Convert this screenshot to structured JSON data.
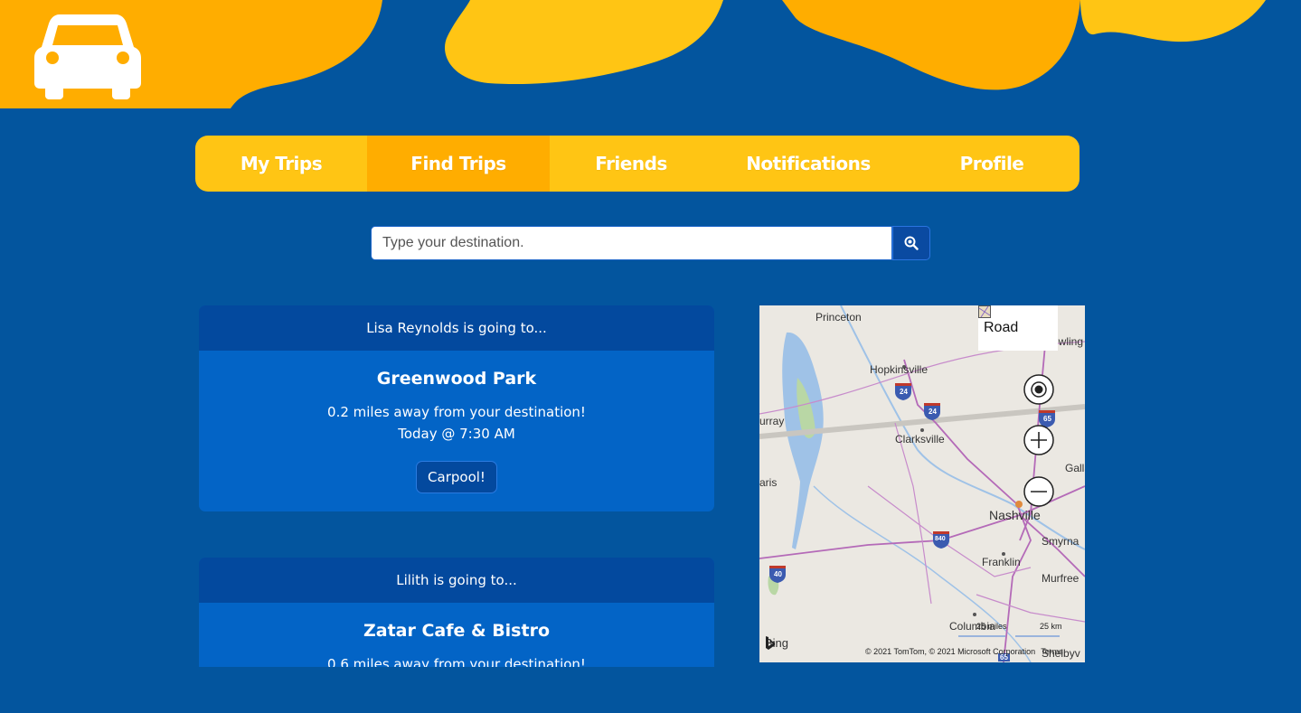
{
  "nav": {
    "items": [
      {
        "label": "My Trips"
      },
      {
        "label": "Find Trips"
      },
      {
        "label": "Friends"
      },
      {
        "label": "Notifications"
      },
      {
        "label": "Profile"
      }
    ],
    "active": "Find Trips"
  },
  "search": {
    "placeholder": "Type your destination."
  },
  "trips": [
    {
      "header": "Lisa Reynolds is going to...",
      "place": "Greenwood Park",
      "distance": "0.2 miles away from your destination!",
      "time": "Today @ 7:30 AM",
      "action": "Carpool!"
    },
    {
      "header": "Lilith is going to...",
      "place": "Zatar Cafe & Bistro",
      "distance": "0.6 miles away from your destination!"
    }
  ],
  "map": {
    "style_label": "Road",
    "labels": {
      "princeton": "Princeton",
      "bowling": "Bowling G",
      "hopkinsville": "Hopkinsville",
      "murray": "urray",
      "clarksville": "Clarksville",
      "gallatin": "Gallat",
      "paris": "aris",
      "nashville": "Nashville",
      "smyrna": "Smyrna",
      "franklin": "Franklin",
      "murfreesboro": "Murfree",
      "columbia": "Columbia",
      "shelbyville": "Shelbyv"
    },
    "shields": [
      "24",
      "24",
      "65",
      "840",
      "40",
      "65"
    ],
    "scale_miles": "25 miles",
    "scale_km": "25 km",
    "provider": "Bing",
    "copyright": "© 2021 TomTom, © 2021 Microsoft Corporation",
    "terms": "Terms"
  },
  "colors": {
    "background": "#03559e",
    "accent_yellow": "#ffc514",
    "accent_orange": "#ffad00",
    "card": "#0364c6",
    "card_header": "#03499e"
  }
}
